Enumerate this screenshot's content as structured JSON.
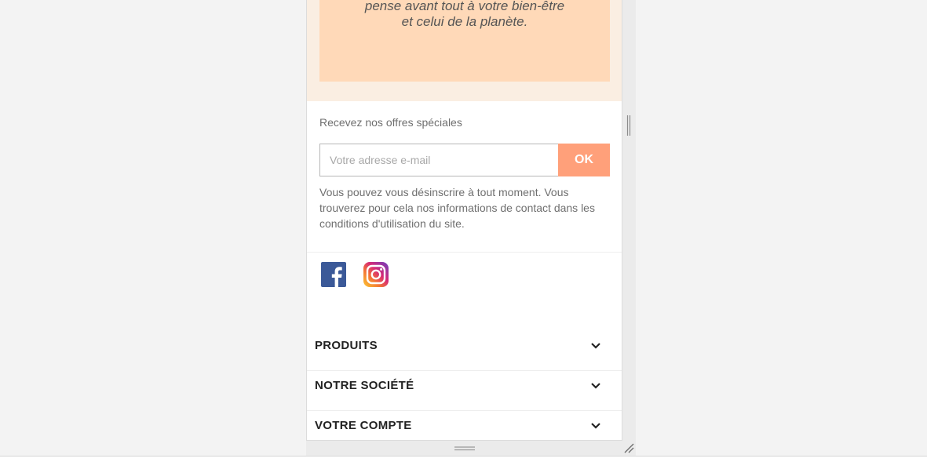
{
  "promo": {
    "line1": "pense avant tout à votre bien-être",
    "line2": "et celui de la planète."
  },
  "newsletter": {
    "title": "Recevez nos offres spéciales",
    "email_placeholder": "Votre adresse e-mail",
    "submit_label": "OK",
    "disclaimer": "Vous pouvez vous désinscrire à tout moment. Vous trouverez pour cela nos informations de contact dans les conditions d'utilisation du site."
  },
  "social": {
    "items": [
      {
        "icon": "facebook-icon"
      },
      {
        "icon": "instagram-icon"
      }
    ]
  },
  "footer_menu": {
    "items": [
      {
        "label": "PRODUITS"
      },
      {
        "label": "NOTRE SOCIÉTÉ"
      },
      {
        "label": "VOTRE COMPTE"
      }
    ]
  },
  "colors": {
    "promo_band": "#faeee2",
    "promo_box": "#ffd9b8",
    "ok_button": "#ffa07a",
    "text_muted": "#6f6f6f",
    "heading": "#222222"
  }
}
